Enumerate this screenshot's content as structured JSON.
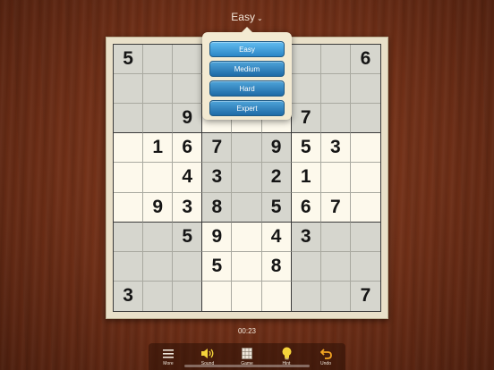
{
  "header": {
    "title": "Easy",
    "chevron": "chevron-down-icon"
  },
  "difficulty_menu": {
    "options": [
      "Easy",
      "Medium",
      "Hard",
      "Expert"
    ],
    "selected": "Easy"
  },
  "board": {
    "rows": [
      [
        "5",
        "",
        "",
        "",
        "",
        "",
        "",
        "",
        "6"
      ],
      [
        "",
        "",
        "",
        "",
        "",
        "",
        "",
        "",
        ""
      ],
      [
        "",
        "",
        "9",
        "",
        "",
        "",
        "7",
        "",
        ""
      ],
      [
        "",
        "1",
        "6",
        "7",
        "",
        "9",
        "5",
        "3",
        ""
      ],
      [
        "",
        "",
        "4",
        "3",
        "",
        "2",
        "1",
        "",
        ""
      ],
      [
        "",
        "9",
        "3",
        "8",
        "",
        "5",
        "6",
        "7",
        ""
      ],
      [
        "",
        "",
        "5",
        "9",
        "",
        "4",
        "3",
        "",
        ""
      ],
      [
        "",
        "",
        "",
        "5",
        "",
        "8",
        "",
        "",
        ""
      ],
      [
        "3",
        "",
        "",
        "",
        "",
        "",
        "",
        "",
        "7"
      ]
    ]
  },
  "timer": "00:23",
  "toolbar": {
    "items": [
      {
        "label": "More",
        "icon": "menu-icon"
      },
      {
        "label": "Sound",
        "icon": "speaker-icon"
      },
      {
        "label": "Game",
        "icon": "game-icon"
      },
      {
        "label": "Hint",
        "icon": "lightbulb-icon"
      },
      {
        "label": "Undo",
        "icon": "undo-icon"
      }
    ]
  },
  "colors": {
    "wood": "#6f2f17",
    "board_light": "#fdf9ec",
    "board_shade": "#d6d6ce",
    "button_blue": "#1e6aa6",
    "icon_yellow": "#f5d33a"
  }
}
